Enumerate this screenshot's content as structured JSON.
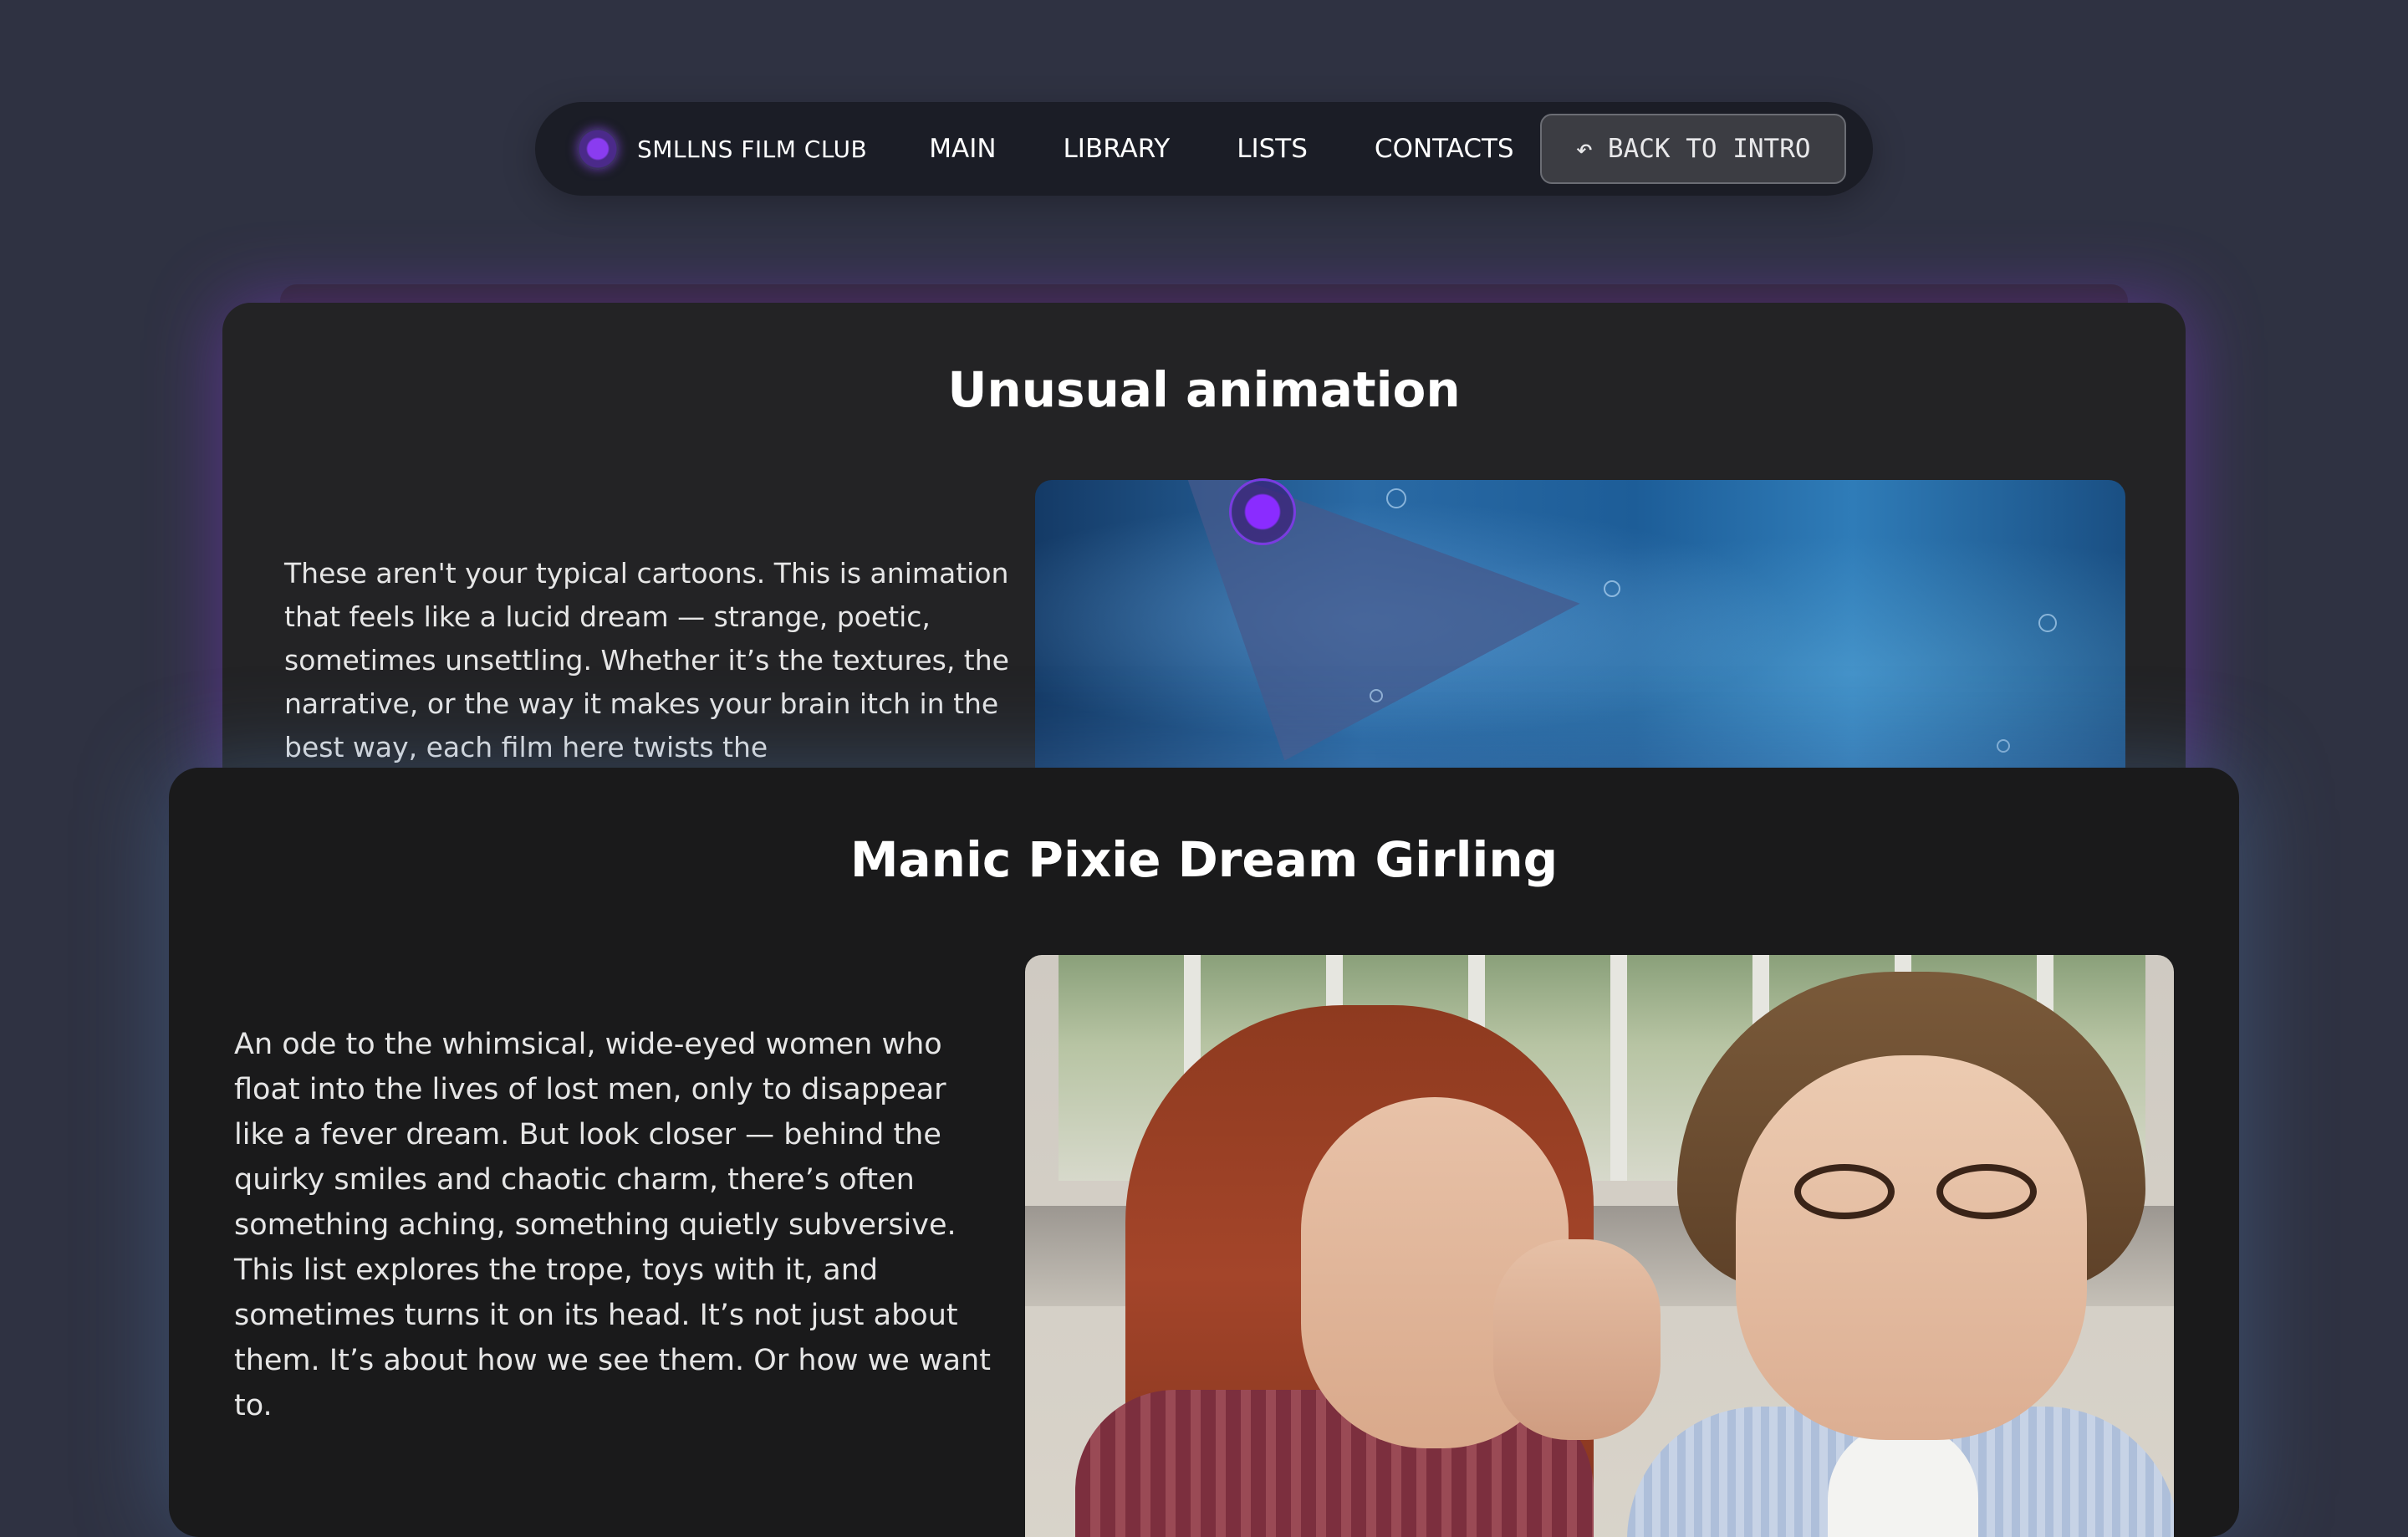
{
  "nav": {
    "brand": "SMLLNS FILM CLUB",
    "links": [
      "MAIN",
      "LIBRARY",
      "LISTS",
      "CONTACTS"
    ],
    "back_label": "BACK TO INTRO",
    "back_icon": "undo-arrow-icon"
  },
  "cards": [
    {
      "title": "Unusual animation",
      "description": "These aren't your typical cartoons. This is animation that feels like a lucid dream — strange, poetic, sometimes unsettling. Whether it’s the textures, the narrative, or the way it makes your brain itch in the best way, each film here twists the",
      "image": "underwater-animation-still"
    },
    {
      "title": "Manic Pixie Dream Girling",
      "description": "An ode to the whimsical, wide-eyed women who float into the lives of lost men, only to disappear like a fever dream. But look closer — behind the quirky smiles and chaotic charm, there’s often something aching, something quietly subversive. This list explores the trope, toys with it, and sometimes turns it on its head. It’s not just about them. It’s about how we see them. Or how we want to.",
      "image": "film-still-two-people"
    }
  ],
  "colors": {
    "background": "#2f3242",
    "accent_purple": "#8a2cff",
    "nav_bg": "#1b1d26"
  }
}
